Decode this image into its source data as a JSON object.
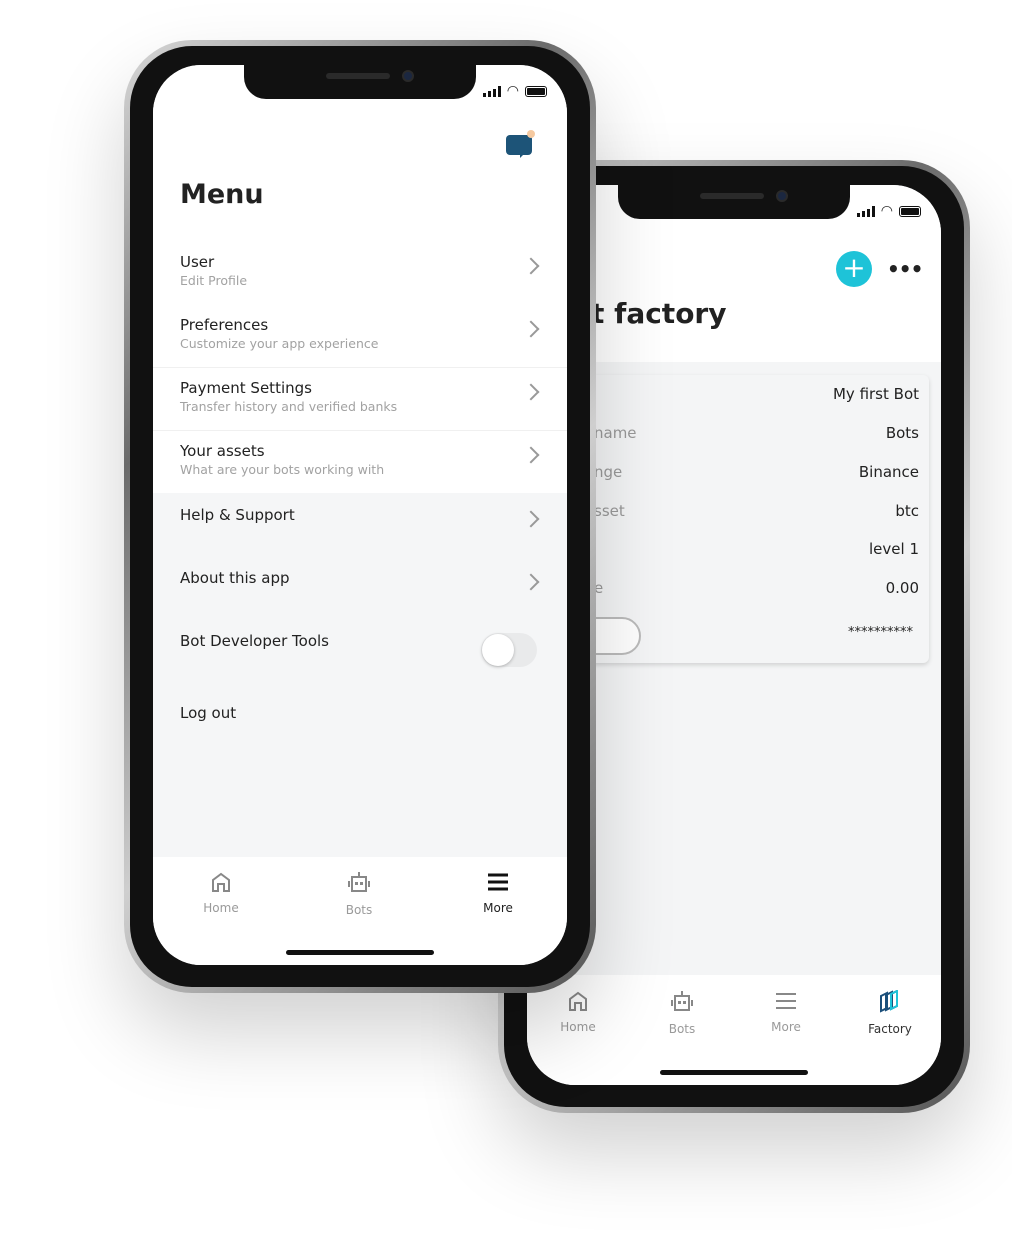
{
  "back_phone": {
    "title": "t factory",
    "card": {
      "rows": [
        {
          "label": "",
          "value": "My first Bot"
        },
        {
          "label": "name",
          "value": "Bots"
        },
        {
          "label": "nge",
          "value": "Binance"
        },
        {
          "label": "sset",
          "value": "btc"
        },
        {
          "label": "",
          "value": "level 1"
        },
        {
          "label": "e",
          "value": "0.00"
        },
        {
          "label": "",
          "value": "**********"
        }
      ]
    },
    "add_button_icon": "plus-icon",
    "more_button_icon": "ellipsis-icon",
    "accent": "#1ec3d8",
    "nav": [
      {
        "label": "Home",
        "icon": "home-icon"
      },
      {
        "label": "Bots",
        "icon": "robot-icon"
      },
      {
        "label": "More",
        "icon": "menu-icon"
      },
      {
        "label": "Factory",
        "icon": "factory-icon",
        "active": true
      }
    ]
  },
  "front_phone": {
    "title": "Menu",
    "chat_icon": "chat-bubble-icon",
    "items": [
      {
        "title": "User",
        "subtitle": "Edit Profile"
      },
      {
        "title": "Preferences",
        "subtitle": "Customize your app experience"
      },
      {
        "title": "Payment Settings",
        "subtitle": "Transfer history and verified banks"
      },
      {
        "title": "Your assets",
        "subtitle": "What are your bots working with"
      },
      {
        "title": "Help & Support"
      },
      {
        "title": "About this app"
      },
      {
        "title": "Bot Developer Tools",
        "toggle": false
      },
      {
        "title": "Log out"
      }
    ],
    "nav": [
      {
        "label": "Home",
        "icon": "home-icon"
      },
      {
        "label": "Bots",
        "icon": "robot-icon"
      },
      {
        "label": "More",
        "icon": "menu-icon",
        "active": true
      }
    ]
  }
}
